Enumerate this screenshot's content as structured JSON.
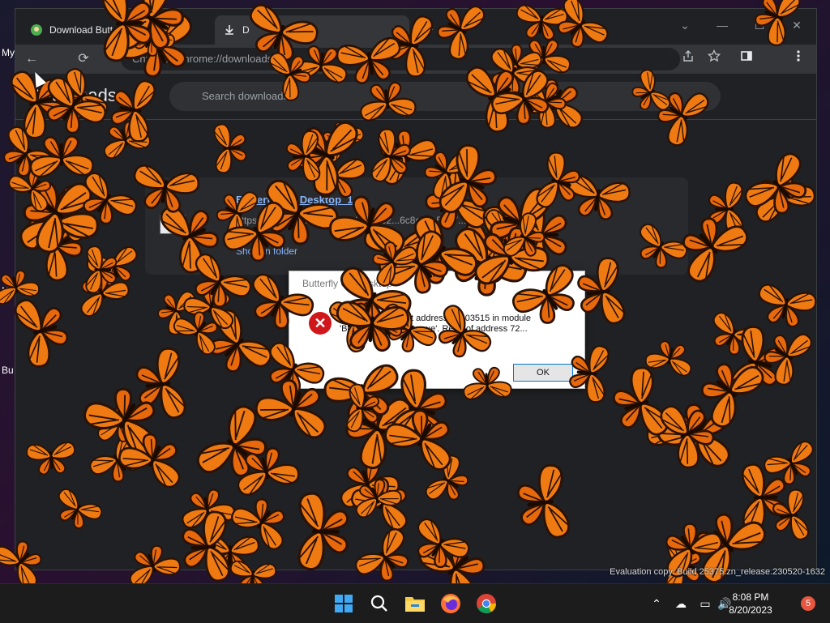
{
  "desktop": {
    "icon_labels": [
      "My",
      "N",
      "Bu"
    ]
  },
  "browser": {
    "tabs": [
      {
        "label": "Download Butterfl",
        "icon": "butterfly-on-desktop-icon",
        "close": "✕"
      },
      {
        "label": "D",
        "icon": "download-icon",
        "close": "✕"
      }
    ],
    "new_tab": "+",
    "window_controls": {
      "dropdown": "⌄",
      "minimize": "—",
      "maximize": "☐",
      "close": "✕"
    },
    "toolbar": {
      "back": "←",
      "reload": "⟳",
      "address": "Chrome | chrome://downloads"
    },
    "page": {
      "title": "Downloads",
      "search_placeholder": "Search downloads",
      "download": {
        "name": "Butterfly On Desktop_1",
        "url": "https://h2ocdn.lavasoft.com/...soft32...6c8ce3a59b7...41ce9e3b",
        "action": "Show in folder"
      }
    }
  },
  "dialog": {
    "title": "Butterfly On Desktop",
    "message": "Access violation at address 00403515 in module 'ButterflyOnDesktop.exe'. Read of address 72...",
    "ok_label": "OK"
  },
  "watermark": "Evaluation copy. Build 25375.zn_release.230520-1632",
  "taskbar": {
    "apps": [
      "start-icon",
      "search-icon",
      "file-explorer-icon",
      "firefox-icon",
      "chrome-icon"
    ],
    "tray": {
      "chevron": "⌃",
      "network": "☁",
      "display": "▭",
      "volume": "🔊"
    },
    "time": "8:08 PM",
    "date": "8/20/2023",
    "notifications": "5"
  },
  "colors": {
    "butterfly_orange": "#f07a12",
    "butterfly_dark": "#2a1205",
    "dialog_error": "#d0171b"
  }
}
